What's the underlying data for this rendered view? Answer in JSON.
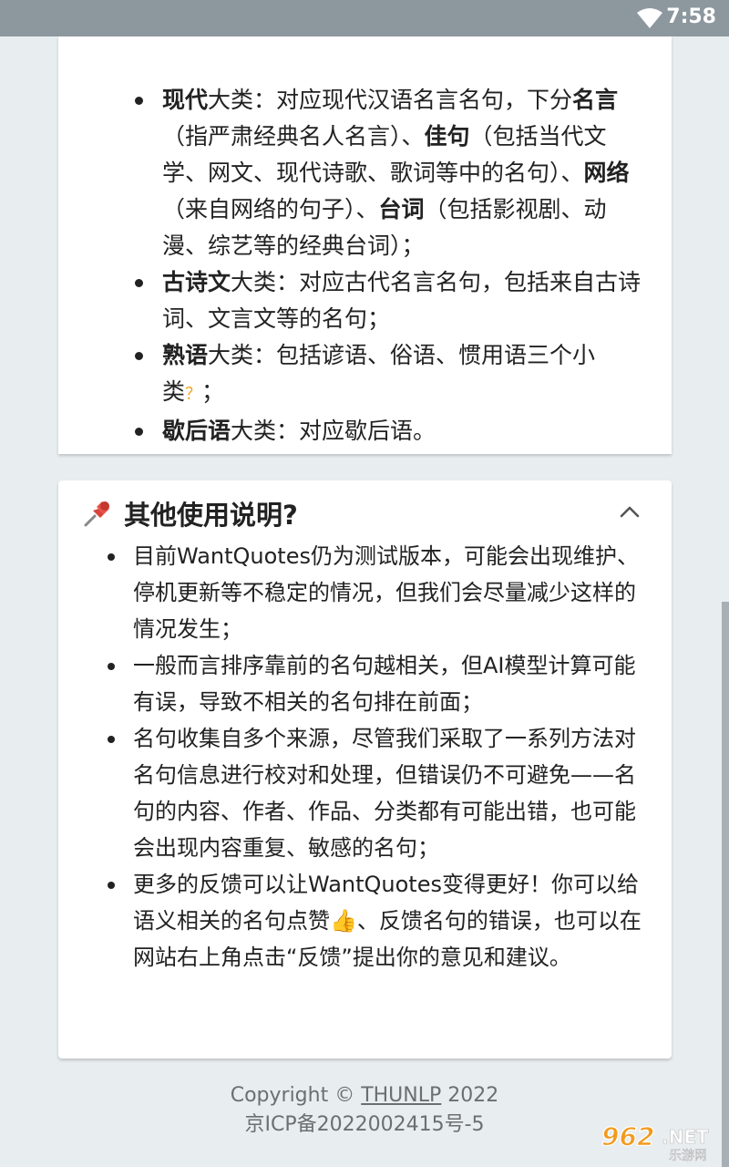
{
  "status": {
    "time": "7:58"
  },
  "categories": {
    "items": [
      {
        "parts": [
          {
            "t": "现代",
            "b": true
          },
          {
            "t": "大类：对应现代汉语名言名句，下分"
          },
          {
            "t": "名言",
            "b": true
          },
          {
            "t": "（指严肃经典名人名言）、"
          },
          {
            "t": "佳句",
            "b": true
          },
          {
            "t": "（包括当代文学、网文、现代诗歌、歌词等中的名句）、"
          },
          {
            "t": "网络",
            "b": true
          },
          {
            "t": "（来自网络的句子）、"
          },
          {
            "t": "台词",
            "b": true
          },
          {
            "t": "（包括影视剧、动漫、综艺等的经典台词）；"
          }
        ]
      },
      {
        "parts": [
          {
            "t": "古诗文",
            "b": true
          },
          {
            "t": "大类：对应古代名言名句，包括来自古诗词、文言文等的名句；"
          }
        ]
      },
      {
        "parts": [
          {
            "t": "熟语",
            "b": true
          },
          {
            "t": "大类：包括谚语、俗语、惯用语三个小类"
          },
          {
            "t": "？",
            "q": true
          },
          {
            "t": "；"
          }
        ]
      },
      {
        "parts": [
          {
            "t": "歇后语",
            "b": true
          },
          {
            "t": "大类：对应歇后语。"
          }
        ]
      }
    ]
  },
  "usage": {
    "title": "其他使用说明?",
    "items": [
      "目前WantQuotes仍为测试版本，可能会出现维护、停机更新等不稳定的情况，但我们会尽量减少这样的情况发生；",
      "一般而言排序靠前的名句越相关，但AI模型计算可能有误，导致不相关的名句排在前面；",
      "名句收集自多个来源，尽管我们采取了一系列方法对名句信息进行校对和处理，但错误仍不可避免——名句的内容、作者、作品、分类都有可能出错，也可能会出现内容重复、敏感的名句；",
      "更多的反馈可以让WantQuotes变得更好！你可以给语义相关的名句点赞👍、反馈名句的错误，也可以在网站右上角点击“反馈”提出你的意见和建议。"
    ]
  },
  "footer": {
    "copyright_prefix": "Copyright © ",
    "org": "THUNLP",
    "year": " 2022",
    "icp": "京ICP备2022002415号-5"
  },
  "watermark": "962.NET 乐游网"
}
